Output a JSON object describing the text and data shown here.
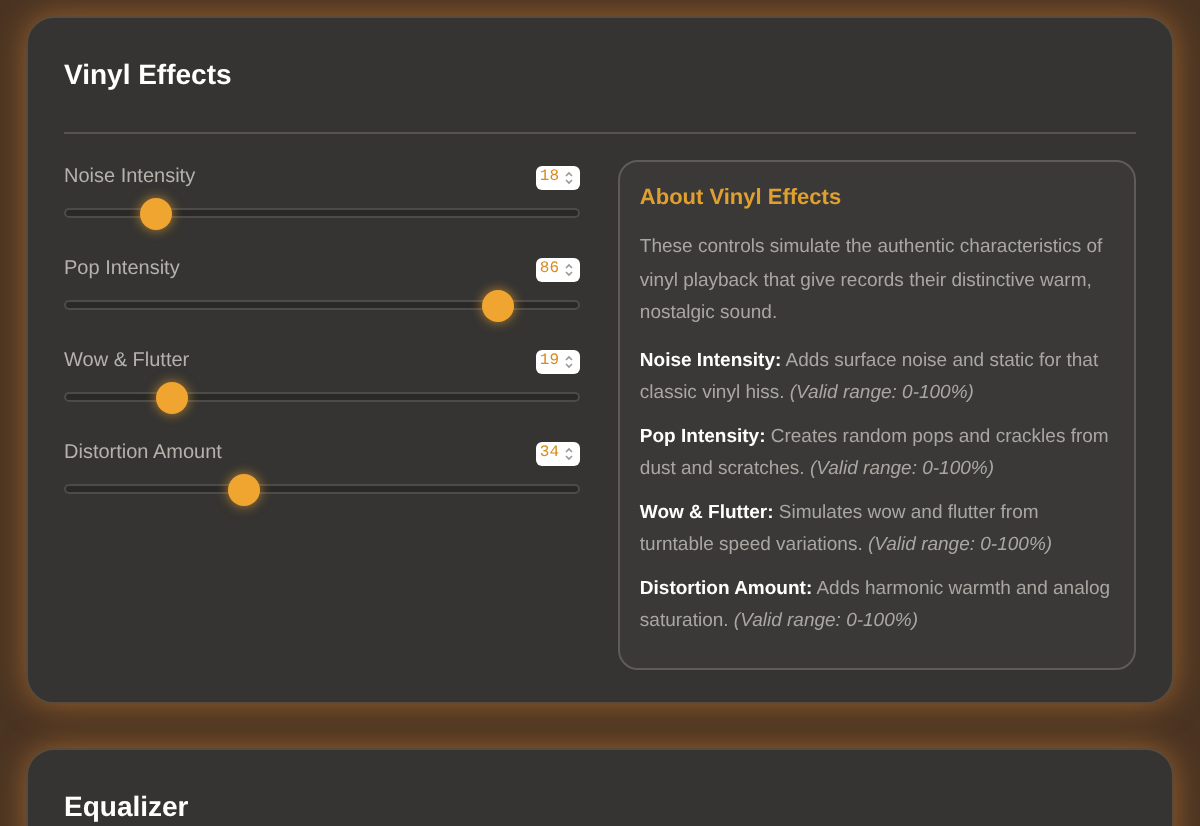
{
  "panels": [
    {
      "title": "Vinyl Effects",
      "sliders": [
        {
          "label": "Noise Intensity",
          "value": "18",
          "level": 0.18
        },
        {
          "label": "Pop Intensity",
          "value": "86",
          "level": 0.84
        },
        {
          "label": "Wow & Flutter",
          "value": "19",
          "level": 0.21
        },
        {
          "label": "Distortion Amount",
          "value": "34",
          "level": 0.35
        }
      ],
      "info": {
        "title": "About Vinyl Effects",
        "intro": "These controls simulate the authentic characteristics of vinyl playback that give records their distinctive warm, nostalgic sound.",
        "items": [
          "**Noise Intensity:** Adds surface noise and static for that classic vinyl hiss. *(Valid range: 0-100%)*",
          "**Pop Intensity:** Creates random pops and crackles from dust and scratches. *(Valid range: 0-100%)*",
          "**Wow & Flutter:** Simulates wow and flutter from turntable speed variations. *(Valid range: 0-100%)*",
          "**Distortion Amount:** Adds harmonic warmth and analog saturation. *(Valid range: 0-100%)*"
        ]
      }
    },
    {
      "title": "Equalizer"
    }
  ]
}
